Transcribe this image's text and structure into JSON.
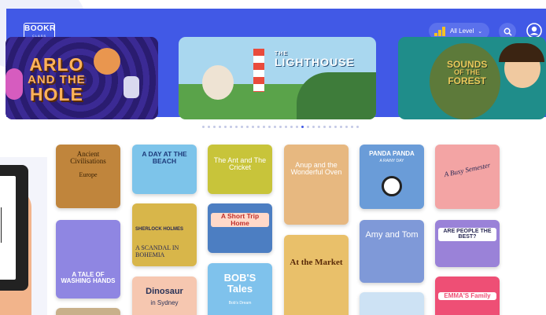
{
  "header": {
    "logo": "BOOKR",
    "logo_sub": "CLASS",
    "level_label": "All Level",
    "colors": {
      "header_bg": "#4159e6",
      "level_bar": "#f5c223"
    }
  },
  "banners": [
    {
      "title_line1": "ARLO",
      "title_line2": "AND THE",
      "title_line3": "HOLE"
    },
    {
      "title": "LIGHTHOUSE",
      "title_prefix": "THE"
    },
    {
      "title_line1": "SOUNDS",
      "title_line2": "OF THE",
      "title_line3": "FOREST"
    }
  ],
  "carousel": {
    "dot_count": 29,
    "active_index": 18
  },
  "books": [
    {
      "title": "Ancient Civilisations",
      "sub": "Europe",
      "bg": "#c0853c",
      "fg": "#3a2205"
    },
    {
      "title": "A TALE OF WASHING HANDS",
      "bg": "#8f86e2",
      "fg": "#ffffff"
    },
    {
      "title": "A DAY AT THE BEACH",
      "bg": "#7dc4ea",
      "fg": "#1d3a7a"
    },
    {
      "title": "SHERLOCK HOLMES",
      "sub": "A SCANDAL IN BOHEMIA",
      "bg": "#d8b64a",
      "fg": "#2a2a55"
    },
    {
      "title": "Dinosaur",
      "sub": "in Sydney",
      "bg": "#f6c7b0",
      "fg": "#2a3358"
    },
    {
      "title": "The Ant and The Cricket",
      "bg": "#c8c43a",
      "fg": "#ffffff"
    },
    {
      "title": "A Short Trip Home",
      "bg": "#4c7ec2",
      "fg": "#c0302c"
    },
    {
      "title": "BOB'S Tales",
      "sub": "Bob's Dream",
      "bg": "#7fc2ec",
      "fg": "#ffffff"
    },
    {
      "title": "Anup and the Wonderful Oven",
      "bg": "#e7b880",
      "fg": "#ffffff"
    },
    {
      "title": "At the Market",
      "bg": "#e9c06a",
      "fg": "#5a2a08"
    },
    {
      "title": "PANDA PANDA",
      "sub": "A RAINY DAY",
      "bg": "#6a9cd8",
      "fg": "#ffffff"
    },
    {
      "title": "Amy and Tom",
      "bg": "#7f99d8",
      "fg": "#ffffff"
    },
    {
      "title": "A Busy Semester",
      "bg": "#f3a4a4",
      "fg": "#2a2a55"
    },
    {
      "title": "ARE PEOPLE THE BEST?",
      "bg": "#9a82d8",
      "fg": "#2a2a55"
    },
    {
      "title": "EMMA'S Family",
      "bg": "#ee4f75",
      "fg": "#ffffff"
    }
  ]
}
